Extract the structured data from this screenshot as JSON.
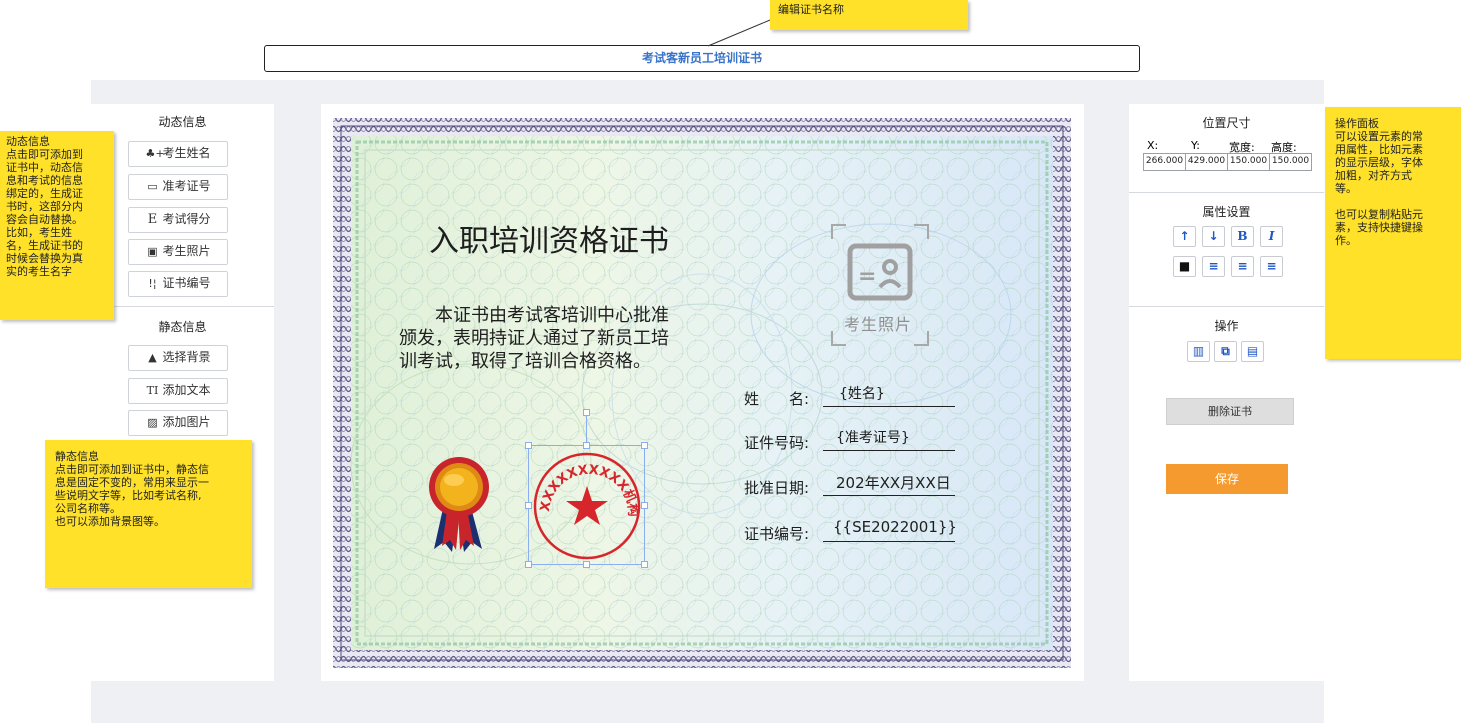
{
  "title_input": {
    "value": "考试客新员工培训证书"
  },
  "callouts": {
    "top": "编辑证书名称",
    "dynamic": [
      "动态信息",
      "点击即可添加到",
      "证书中，动态信",
      "息和考试的信息",
      "绑定的，生成证",
      "书时，这部分内",
      "容会自动替换。",
      "比如，考生姓",
      "名，生成证书的",
      "时候会替换为真",
      "实的考生名字"
    ],
    "static": [
      "静态信息",
      "点击即可添加到证书中，静态信",
      "息是固定不变的，常用来显示一",
      "些说明文字等，比如考试名称,",
      "公司名称等。",
      "也可以添加背景图等。"
    ],
    "right": [
      "操作面板",
      "可以设置元素的常",
      "用属性，比如元素",
      "的显示层级，字体",
      "加粗，对齐方式",
      "等。",
      "",
      "也可以复制粘贴元",
      "素，支持快捷键操",
      "作。"
    ]
  },
  "left_panel": {
    "dynamic_title": "动态信息",
    "dynamic_buttons": [
      {
        "icon": "person-add-icon",
        "label": "考生姓名"
      },
      {
        "icon": "card-icon",
        "label": "准考证号"
      },
      {
        "icon": "score-icon",
        "label": "考试得分"
      },
      {
        "icon": "id-photo-icon",
        "label": "考生照片"
      },
      {
        "icon": "number-icon",
        "label": "证书编号"
      }
    ],
    "static_title": "静态信息",
    "static_buttons": [
      {
        "icon": "landscape-icon",
        "label": "选择背景"
      },
      {
        "icon": "text-icon",
        "label": "添加文本"
      },
      {
        "icon": "image-icon",
        "label": "添加图片"
      }
    ]
  },
  "certificate": {
    "heading": "入职培训资格证书",
    "body_lines": [
      "本证书由考试客培训中心批准",
      "颁发，表明持证人通过了新员工培",
      "训考试，取得了培训合格资格。"
    ],
    "photo_label": "考生照片",
    "seal_text": "XXXXXXXXXX机构",
    "fields": [
      {
        "label": "姓　　名:",
        "value": "{姓名}"
      },
      {
        "label": "证件号码:",
        "value": "{准考证号}"
      },
      {
        "label": "批准日期:",
        "value": "202年XX月XX日"
      },
      {
        "label": "证书编号:",
        "value": "{{SE2022001}}"
      }
    ]
  },
  "right_panel": {
    "position_title": "位置尺寸",
    "coord_labels": [
      "X:",
      "Y:",
      "宽度:",
      "高度:"
    ],
    "coord_values": [
      "266.000",
      "429.000",
      "150.000",
      "150.000"
    ],
    "attr_title": "属性设置",
    "attr_buttons_row1": [
      "↑",
      "↓",
      "B",
      "I"
    ],
    "ops_title": "操作",
    "delete_label": "删除证书",
    "save_label": "保存"
  },
  "colors": {
    "accent": "#3a74c8",
    "save": "#f59a2f",
    "note": "#ffe12a",
    "seal": "#d7262b"
  }
}
